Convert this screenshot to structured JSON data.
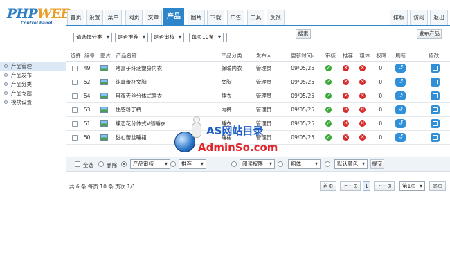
{
  "logo": {
    "brand_main": "PHP",
    "brand_accent": "WEB",
    "subtitle": "Control Panel"
  },
  "nav": {
    "tabs": [
      "首页",
      "设置",
      "菜单",
      "网页",
      "文章",
      "产品",
      "图片",
      "下载",
      "广告",
      "工具",
      "反馈"
    ],
    "active": "产品",
    "right_tabs": [
      "排版",
      "访问",
      "退出"
    ]
  },
  "sidebar": {
    "items": [
      "产品管理",
      "产品发布",
      "产品分类",
      "产品专题",
      "模块设置"
    ],
    "active": "产品管理"
  },
  "filter": {
    "category": "请选择分类",
    "recommend": "是否推荐",
    "audit": "是否审核",
    "per_page": "每页10条",
    "search_value": "",
    "search_button": "搜索",
    "publish_button": "发布产品"
  },
  "table": {
    "headers": [
      "选择",
      "编号",
      "图片",
      "产品名称",
      "产品分类",
      "发布人",
      "更新时间",
      "审核",
      "推荐",
      "粗体",
      "权限",
      "刷新",
      "修改"
    ],
    "rows": [
      {
        "id": "49",
        "name": "睹富子纤涵塑身内衣",
        "category": "保暖内衣",
        "author": "管理员",
        "date": "09/05/25",
        "audit": true,
        "recommend": false,
        "bold": false,
        "perm": "0"
      },
      {
        "id": "52",
        "name": "纯真蕾杯文胸",
        "category": "文胸",
        "author": "管理员",
        "date": "09/05/25",
        "audit": true,
        "recommend": false,
        "bold": false,
        "perm": "0"
      },
      {
        "id": "54",
        "name": "月夜天丝分体式睡衣",
        "category": "睡衣",
        "author": "管理员",
        "date": "09/05/25",
        "audit": true,
        "recommend": false,
        "bold": false,
        "perm": "0"
      },
      {
        "id": "53",
        "name": "性感粉丁裤",
        "category": "内裤",
        "author": "管理员",
        "date": "09/05/25",
        "audit": true,
        "recommend": false,
        "bold": false,
        "perm": "0"
      },
      {
        "id": "51",
        "name": "蝶恋花分体式V领睡衣",
        "category": "睡衣",
        "author": "管理员",
        "date": "09/05/25",
        "audit": true,
        "recommend": false,
        "bold": false,
        "perm": "0"
      },
      {
        "id": "50",
        "name": "甜心蕾丝睡裙",
        "category": "睡裙",
        "author": "管理员",
        "date": "09/05/25",
        "audit": true,
        "recommend": false,
        "bold": false,
        "perm": "0"
      }
    ]
  },
  "bulk": {
    "select_all": "全选",
    "delete": "删除",
    "audit_select": "产品审核",
    "recommend_select": "推荐",
    "perm_select": "阅读权限",
    "bold_select": "粗体",
    "color_select": "默认颜色",
    "submit": "提交"
  },
  "pager": {
    "info": "共 6 条 每页 10 条 页次 1/1",
    "first": "首页",
    "prev": "上一页",
    "current": "1",
    "next": "下一页",
    "jump": "第1页",
    "last": "尾页"
  },
  "watermark": {
    "line1": "AS网站目录",
    "line2": "AdminSo.com"
  },
  "colors": {
    "accent": "#2d86c9",
    "ok": "#3aa93a",
    "no": "#d62828",
    "watermark_blue": "#1f5fc6",
    "watermark_red": "#e0262b"
  },
  "icons": {
    "audit_on": "check-circle-icon",
    "off": "x-circle-icon",
    "refresh": "refresh-icon",
    "edit": "edit-icon",
    "thumb": "image-icon"
  }
}
